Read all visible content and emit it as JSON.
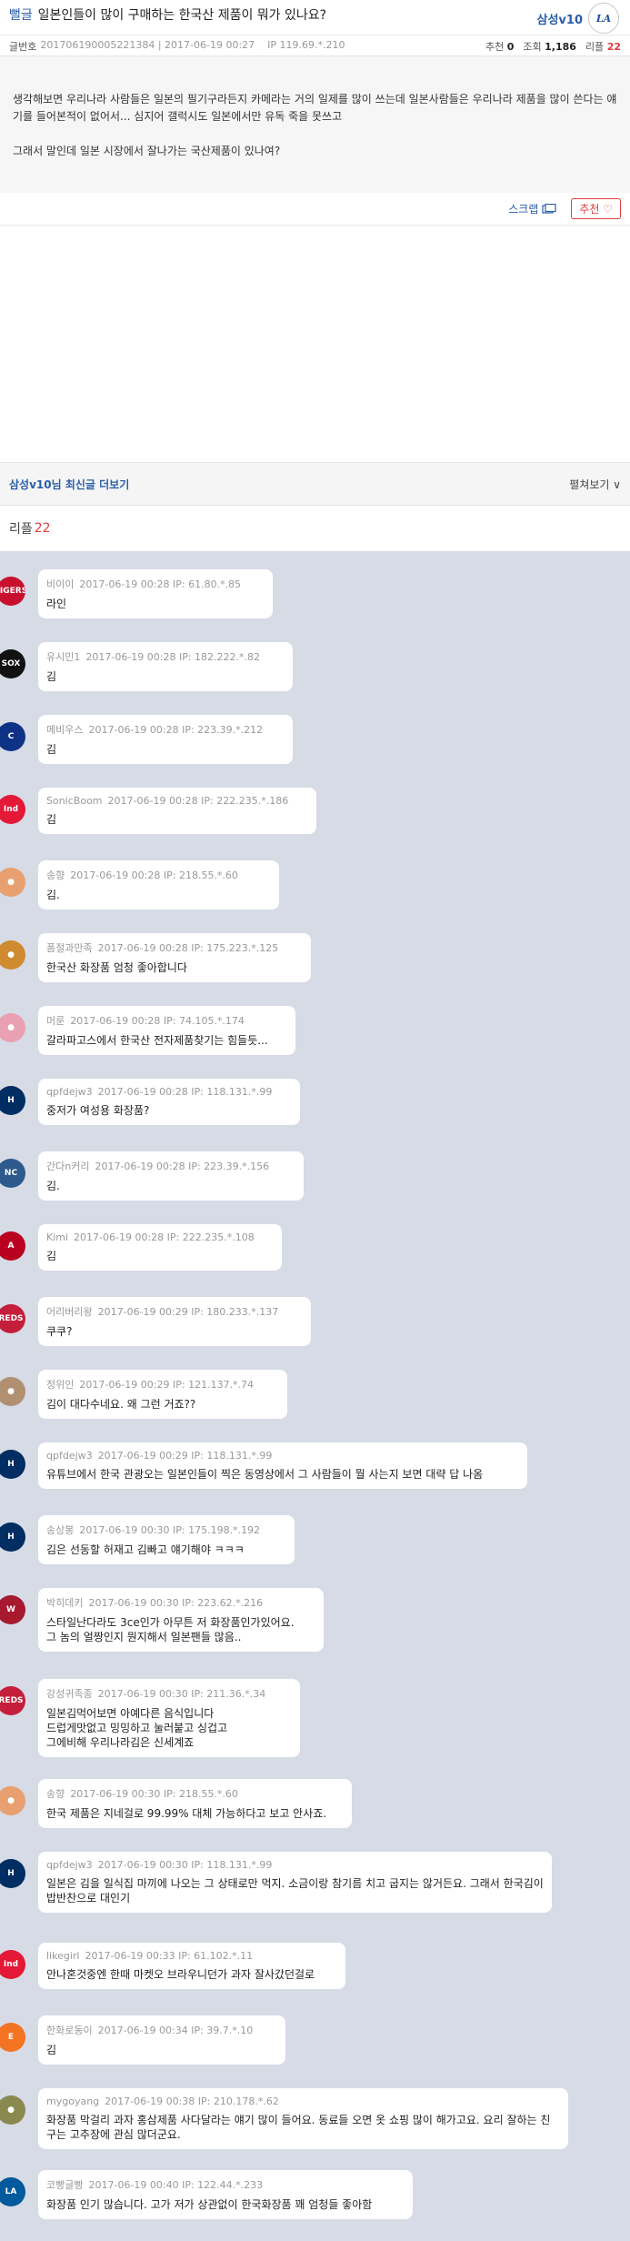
{
  "post": {
    "category": "뻘글",
    "title": "일본인들이 많이 구매하는 한국산 제품이 뭐가 있나요?",
    "author": "삼성v10",
    "author_logo": "LA",
    "meta": {
      "number_label": "글번호",
      "number": "201706190005221384 | 2017-06-19 00:27",
      "ip": "IP 119.69.*.210",
      "recommend_label": "추천",
      "recommend": "0",
      "views_label": "조회",
      "views": "1,186",
      "replies_label": "리플",
      "replies": "22"
    },
    "body": "생각해보면 우리나라 사람들은 일본의 필기구라든지 카메라는 거의 일제를 많이 쓰는데 일본사람들은 우리나라 제품을 많이 쓴다는 얘기를 들어본적이 없어서... 심지어 갤럭시도 일본에서만 유독 죽을 못쓰고\n\n그래서 말인데 일본 시장에서 잘나가는 국산제품이 있나여?",
    "scrap_label": "스크랩",
    "recommend_btn": "추천 ♡"
  },
  "more": {
    "label": "삼성v10님 최신글 더보기",
    "expand": "펼쳐보기 ∨"
  },
  "reply_header": {
    "label": "리플",
    "count": "22"
  },
  "replies": [
    {
      "nick": "비이이",
      "meta": "2017-06-19 00:28  IP: 61.80.*.85",
      "text": "라인",
      "color": "#c8102e",
      "logo": "TIGERS"
    },
    {
      "nick": "유시민1",
      "meta": "2017-06-19 00:28  IP: 182.222.*.82",
      "text": "김",
      "color": "#111111",
      "logo": "SOX"
    },
    {
      "nick": "메비우스",
      "meta": "2017-06-19 00:28  IP: 223.39.*.212",
      "text": "김",
      "color": "#0e3386",
      "logo": "C"
    },
    {
      "nick": "SonicBoom",
      "meta": "2017-06-19 00:28  IP: 222.235.*.186",
      "text": "김",
      "color": "#e31937",
      "logo": "Ind"
    },
    {
      "nick": "송향",
      "meta": "2017-06-19 00:28  IP: 218.55.*.60",
      "text": "김.",
      "color": "#e8a070",
      "logo": "●"
    },
    {
      "nick": "폼절과만족",
      "meta": "2017-06-19 00:28  IP: 175.223.*.125",
      "text": "한국산 화장품 엄청 좋아합니다",
      "color": "#d08a30",
      "logo": "●"
    },
    {
      "nick": "머룬",
      "meta": "2017-06-19 00:28  IP: 74.105.*.174",
      "text": "갈라파고스에서 한국산 전자제품찾기는 힘들듯...",
      "color": "#e9a0b0",
      "logo": "●"
    },
    {
      "nick": "qpfdejw3",
      "meta": "2017-06-19 00:28  IP: 118.131.*.99",
      "text": "중저가 여성용 화장품?",
      "color": "#002d62",
      "logo": "H"
    },
    {
      "nick": "간다n커리",
      "meta": "2017-06-19 00:28  IP: 223.39.*.156",
      "text": "김.",
      "color": "#2d5a8c",
      "logo": "NC"
    },
    {
      "nick": "Kimi",
      "meta": "2017-06-19 00:28  IP: 222.235.*.108",
      "text": "김",
      "color": "#ba0021",
      "logo": "A"
    },
    {
      "nick": "어리버리왕",
      "meta": "2017-06-19 00:29  IP: 180.233.*.137",
      "text": "쿠쿠?",
      "color": "#c41e3a",
      "logo": "REDS"
    },
    {
      "nick": "정위인",
      "meta": "2017-06-19 00:29  IP: 121.137.*.74",
      "text": "김이 대다수네요. 왜 그런 거죠??",
      "color": "#b09070",
      "logo": "●"
    },
    {
      "nick": "qpfdejw3",
      "meta": "2017-06-19 00:29  IP: 118.131.*.99",
      "text": "유튜브에서 한국 관광오는 일본인들이 찍은 동영상에서 그 사람들이 뭘 사는지 보면 대략 답 나옴",
      "color": "#002d62",
      "logo": "H"
    },
    {
      "nick": "송상봉",
      "meta": "2017-06-19 00:30  IP: 175.198.*.192",
      "text": "김은 선동할 허재고 김빠고 얘기해야 ㅋㅋㅋ",
      "color": "#002d62",
      "logo": "H"
    },
    {
      "nick": "박히데키",
      "meta": "2017-06-19 00:30  IP: 223.62.*.216",
      "text": "스타일난다라도 3ce인가 아무튼 저 화장품인가있어요.\n그 놈의 얼짱인지 뭔지해서 일본팬들 많음..",
      "color": "#a6192e",
      "logo": "W"
    },
    {
      "nick": "강성귀족종",
      "meta": "2017-06-19 00:30  IP: 211.36.*.34",
      "text": "일본김먹어보면 아예다른 음식입니다\n드럽게맛없고 밍밍하고 눌러붙고 싱겁고\n그에비해 우리나라김은 신세계죠",
      "color": "#c41e3a",
      "logo": "REDS"
    },
    {
      "nick": "송향",
      "meta": "2017-06-19 00:30  IP: 218.55.*.60",
      "text": "한국 제품은 지네걸로 99.99% 대체 가능하다고 보고 안사죠.",
      "color": "#e8a070",
      "logo": "●"
    },
    {
      "nick": "qpfdejw3",
      "meta": "2017-06-19 00:30  IP: 118.131.*.99",
      "text": "일본은 김을 일식집 마끼에 나오는 그 상태로만 먹지. 소금이랑 참기름 치고 굽지는 않거든요. 그래서 한국김이 밥반찬으로 대인기",
      "color": "#002d62",
      "logo": "H"
    },
    {
      "nick": "likegirl",
      "meta": "2017-06-19 00:33  IP: 61.102.*.11",
      "text": "안나혼것중엔 한때 마켓오 브라우니던가 과자 잘사갔던걸로",
      "color": "#e31937",
      "logo": "Ind"
    },
    {
      "nick": "한화로동이",
      "meta": "2017-06-19 00:34  IP: 39.7.*.10",
      "text": "김",
      "color": "#f37321",
      "logo": "E"
    },
    {
      "nick": "mygoyang",
      "meta": "2017-06-19 00:38  IP: 210.178.*.62",
      "text": "화장품 막걸리 과자 홍삼제품 사다달라는 얘기 많이 들어요. 동료들 오면 옷 쇼핑 많이 해가고요. 요리 잘하는 친구는 고추장에 관심 많더군요.",
      "color": "#8a8a50",
      "logo": "●"
    },
    {
      "nick": "코빵글빵",
      "meta": "2017-06-19 00:40  IP: 122.44.*.233",
      "text": "화장품 인기 많습니다. 고가 저가 상관없이 한국화장품 꽤 엄청들 좋아함",
      "color": "#005a9c",
      "logo": "LA"
    }
  ]
}
